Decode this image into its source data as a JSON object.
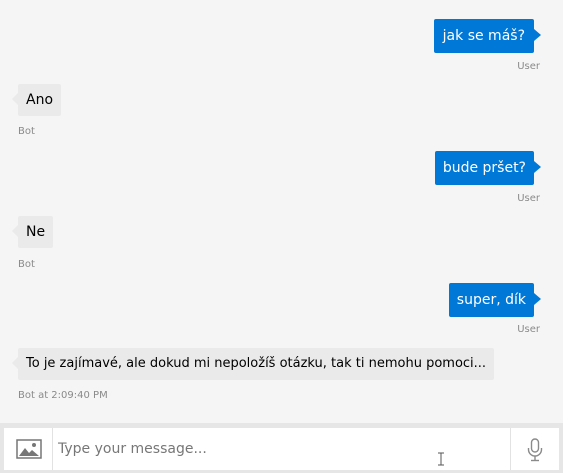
{
  "messages": [
    {
      "from": "user",
      "text": "jak se máš?",
      "meta": "User"
    },
    {
      "from": "bot",
      "text": "Ano",
      "meta": "Bot"
    },
    {
      "from": "user",
      "text": "bude pršet?",
      "meta": "User"
    },
    {
      "from": "bot",
      "text": "Ne",
      "meta": "Bot"
    },
    {
      "from": "user",
      "text": "super, dík",
      "meta": "User"
    },
    {
      "from": "bot",
      "text": "To je zajímavé, ale dokud mi nepoložíš otázku, tak ti nemohu pomoci...",
      "meta": "Bot at 2:09:40 PM"
    }
  ],
  "input": {
    "placeholder": "Type your message...",
    "value": ""
  },
  "icons": {
    "image_upload": "image-icon",
    "microphone": "microphone-icon"
  },
  "colors": {
    "user_bubble": "#0078d7",
    "bot_bubble": "#eaeaea",
    "background": "#f5f5f5"
  }
}
